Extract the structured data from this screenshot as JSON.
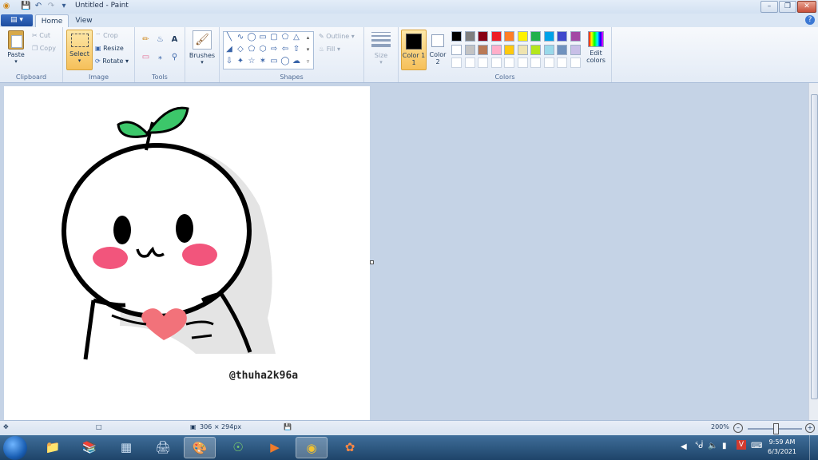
{
  "window": {
    "title": "Untitled - Paint"
  },
  "menu": {
    "file": "▤ ▾",
    "tabs": [
      "Home",
      "View"
    ]
  },
  "ribbon": {
    "clipboard": {
      "label": "Clipboard",
      "paste": "Paste",
      "cut": "Cut",
      "copy": "Copy"
    },
    "image": {
      "label": "Image",
      "select": "Select",
      "crop": "Crop",
      "resize": "Resize",
      "rotate": "Rotate"
    },
    "tools": {
      "label": "Tools"
    },
    "brushes": {
      "label": "Brushes"
    },
    "shapes": {
      "label": "Shapes",
      "outline": "Outline",
      "fill": "Fill"
    },
    "size": {
      "label": "Size"
    },
    "colors": {
      "label": "Colors",
      "color1_label": "Color 1",
      "color1_num": "1",
      "color1_value": "#000000",
      "color2_label": "Color",
      "color2_num": "2",
      "color2_value": "#ffffff",
      "edit_label": "Edit",
      "edit_label2": "colors",
      "palette": [
        "#000000",
        "#7f7f7f",
        "#880015",
        "#ed1c24",
        "#ff7f27",
        "#fff200",
        "#22b14c",
        "#00a2e8",
        "#3f48cc",
        "#a349a4",
        "#ffffff",
        "#c3c3c3",
        "#b97a57",
        "#ffaec9",
        "#ffc90e",
        "#efe4b0",
        "#b5e61d",
        "#99d9ea",
        "#7092be",
        "#c8bfe7",
        "#ffffff",
        "#ffffff",
        "#ffffff",
        "#ffffff",
        "#ffffff",
        "#ffffff",
        "#ffffff",
        "#ffffff",
        "#ffffff",
        "#ffffff"
      ]
    }
  },
  "canvas": {
    "watermark": "@thuha2k96a"
  },
  "status": {
    "dimensions": "306 × 294px",
    "zoom": "200%"
  },
  "clock": {
    "time": "9:59 AM",
    "date": "6/3/2021"
  }
}
